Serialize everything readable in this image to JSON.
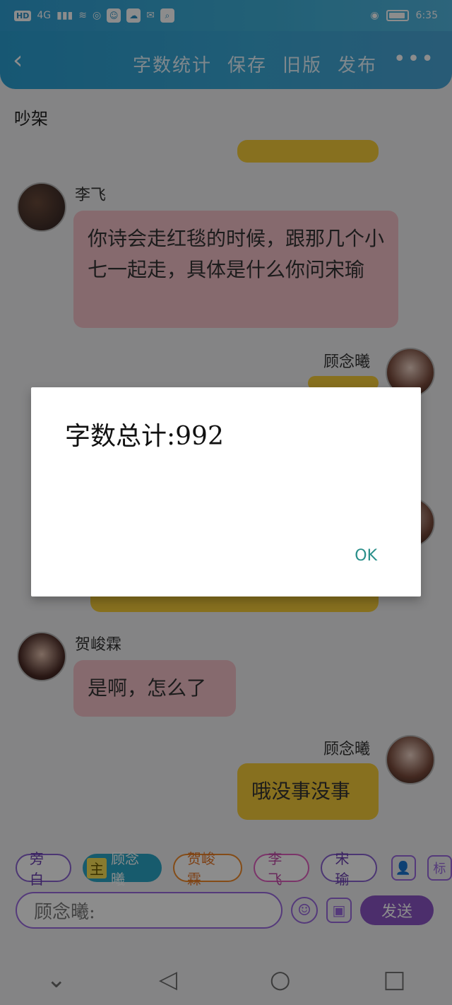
{
  "status_bar": {
    "hd_label": "HD",
    "signal_label": "4G",
    "time": "6:35",
    "icons": [
      "wifi-icon",
      "hotspot-icon",
      "app-icon",
      "cloud-icon",
      "wechat-icon",
      "search-app-icon",
      "eye-icon",
      "battery-icon"
    ]
  },
  "header": {
    "back_icon": "chevron-left-icon",
    "actions": [
      "字数统计",
      "保存",
      "旧版",
      "发布"
    ],
    "more_icon": "more-dots-icon",
    "more_label": "•••",
    "colors": {
      "bar": "#35a6d6"
    }
  },
  "chat": {
    "title": "吵架",
    "messages": [
      {
        "sender": "李飞",
        "text": "你诗会走红毯的时候，跟那几个小七一起走，具体是什么你问宋瑜",
        "side": "left",
        "color": "pink"
      },
      {
        "sender": "顾念曦",
        "text": "",
        "side": "right",
        "color": "yellow"
      },
      {
        "sender": "贺峻霖",
        "text": "是啊，怎么了",
        "side": "left",
        "color": "pink"
      },
      {
        "sender": "顾念曦",
        "text": "哦没事没事",
        "side": "right",
        "color": "yellow"
      }
    ]
  },
  "dialog": {
    "message": "字数总计:992",
    "ok_label": "OK"
  },
  "composer": {
    "chips": [
      {
        "label": "旁白",
        "style": "purple"
      },
      {
        "tag": "主",
        "label": "顾念曦",
        "style": "main"
      },
      {
        "label": "贺峻霖",
        "style": "orange"
      },
      {
        "label": "李飞",
        "style": "pink"
      },
      {
        "label": "宋瑜",
        "style": "purple"
      }
    ],
    "right_icons": {
      "user_icon": "user-icon",
      "tag_label": "标"
    },
    "input_value": "顾念曦:",
    "emoji_icon": "emoji-icon",
    "image_icon": "image-icon",
    "send_label": "发送",
    "colors": {
      "accent": "#8a55c5",
      "main_chip": "#2aa7c7",
      "main_tag": "#f7e057"
    }
  },
  "navbar": {
    "icons": [
      "chevron-down-icon",
      "back-triangle-icon",
      "home-circle-icon",
      "recent-square-icon"
    ]
  }
}
